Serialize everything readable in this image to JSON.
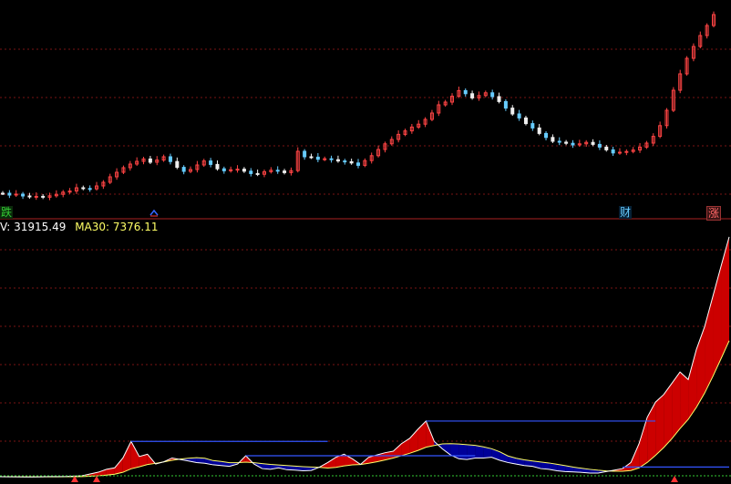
{
  "upper_panel": {
    "series": {
      "close": [
        18,
        17,
        17.5,
        16.5,
        16,
        16.3,
        15.8,
        16.6,
        17.4,
        18.6,
        19.2,
        21,
        20.6,
        20.4,
        22,
        24,
        27,
        29.5,
        32,
        34,
        35.5,
        36.8,
        35,
        36.2,
        38,
        35.4,
        32.2,
        30,
        31,
        33.5,
        35.7,
        33.8,
        31.4,
        30.3,
        30.9,
        31.2,
        30.1,
        28.8,
        28.4,
        29.8,
        30.6,
        30.2,
        29.3,
        30.4,
        41,
        38,
        37.8,
        36.6,
        36.9,
        36.4,
        35.7,
        35.3,
        34.6,
        33.3,
        35.9,
        38.6,
        42,
        45.1,
        47.5,
        50.3,
        52.2,
        54.3,
        55.9,
        58.5,
        62,
        66.5,
        68,
        71.2,
        74.3,
        72.6,
        70.3,
        71.6,
        73.1,
        71,
        68.3,
        64.7,
        61.5,
        59.3,
        56.2,
        53.8,
        50.8,
        48.6,
        46.5,
        46,
        45.4,
        44.5,
        45.1,
        45.9,
        44.8,
        43.3,
        41.8,
        40.1,
        40.5,
        40.9,
        41.7,
        43.3,
        45.5,
        49.2,
        55.1,
        63.5,
        74.5,
        83.5,
        92,
        98.5,
        104.5,
        110,
        116
      ]
    },
    "tags": {
      "die": "跌",
      "arrow": "^",
      "cai": "财",
      "zhang": "涨"
    }
  },
  "lower_panel": {
    "info": {
      "vol_label": "V: 31915.49",
      "ma_label": "MA30: 7376.11"
    },
    "series": {
      "volume": [
        120,
        110,
        100,
        95,
        90,
        110,
        140,
        130,
        150,
        200,
        250,
        480,
        720,
        1100,
        1300,
        2600,
        4800,
        2800,
        3100,
        1800,
        2100,
        2600,
        2400,
        2200,
        2000,
        1900,
        1700,
        1600,
        1500,
        1800,
        2900,
        1800,
        1200,
        1100,
        1300,
        1050,
        1000,
        900,
        950,
        1400,
        2000,
        2700,
        3100,
        2500,
        1750,
        2700,
        3000,
        3300,
        3500,
        4500,
        5200,
        6400,
        7500,
        4800,
        3800,
        3000,
        2500,
        2400,
        2600,
        2600,
        2700,
        2300,
        2000,
        1800,
        1600,
        1500,
        1200,
        1100,
        900,
        800,
        750,
        700,
        600,
        600,
        800,
        1000,
        1200,
        2000,
        4500,
        8000,
        10000,
        11000,
        12500,
        14000,
        13000,
        17000,
        20000,
        24000,
        28000,
        31915
      ]
    },
    "colors": {
      "rise": "#cc0000",
      "fall": "#000099",
      "ma_line": "#ffff66",
      "vol_line": "#ffffff",
      "level_line": "#3355ff",
      "grid": "#7a1515",
      "separator": "#aa2222",
      "baseline": "#33cc33"
    }
  }
}
